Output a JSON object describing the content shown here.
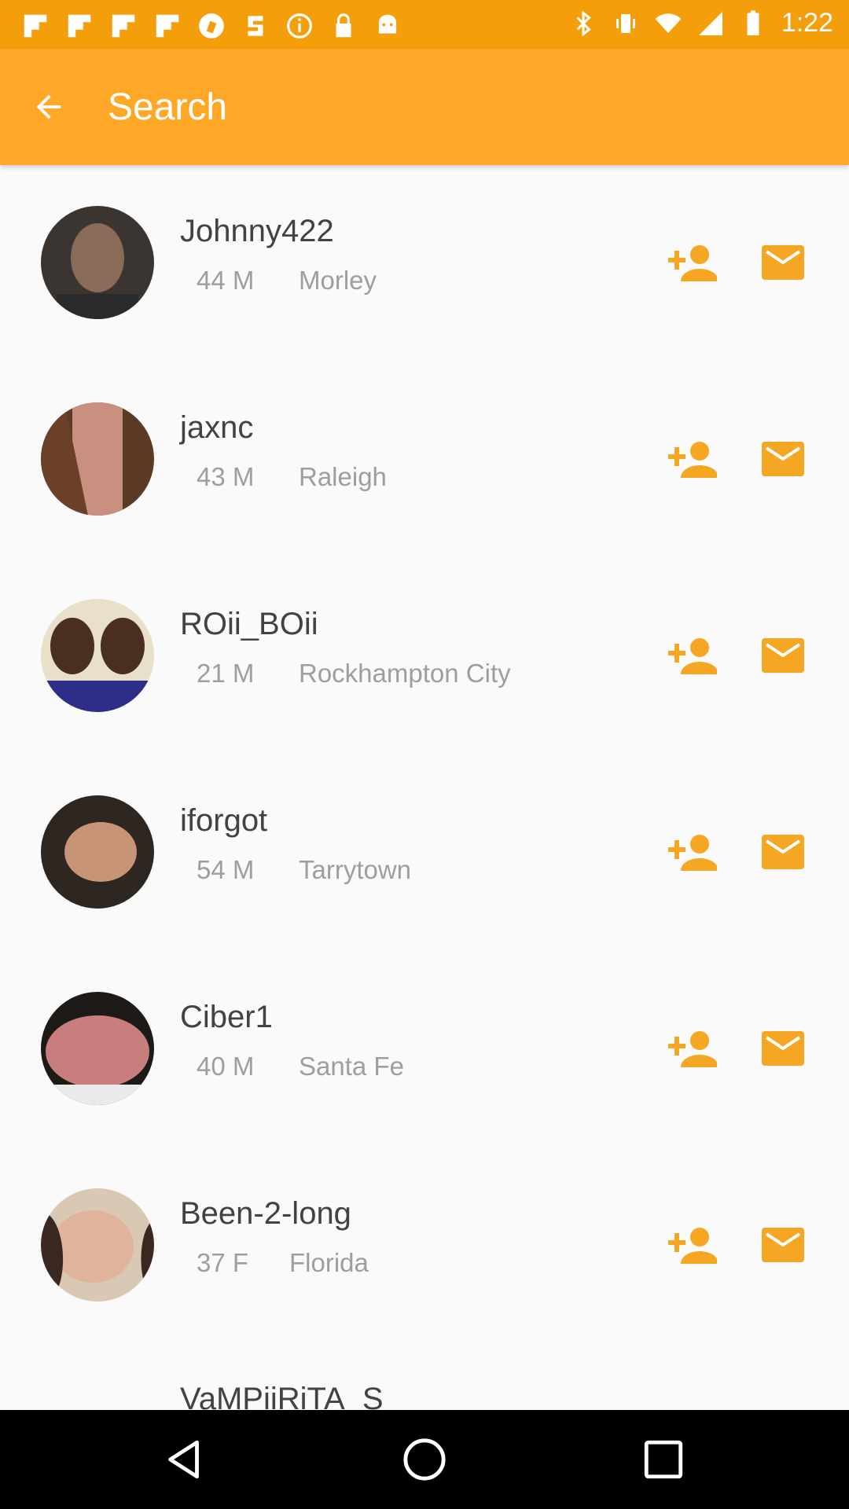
{
  "status_bar": {
    "time": "1:22",
    "left_icons": [
      "flipboard-icon",
      "flipboard-icon",
      "flipboard-icon",
      "flipboard-icon",
      "maps-icon",
      "sharper-icon",
      "info-icon",
      "lock-icon",
      "android-icon"
    ],
    "right_icons": [
      "bluetooth-icon",
      "vibrate-icon",
      "wifi-icon",
      "signal-icon",
      "battery-icon"
    ]
  },
  "app_bar": {
    "title": "Search",
    "back_icon": "arrow-back-icon",
    "color": "#ffa726"
  },
  "results": [
    {
      "username": "Johnny422",
      "age": "44 M",
      "city": "Morley"
    },
    {
      "username": "jaxnc",
      "age": "43 M",
      "city": "Raleigh"
    },
    {
      "username": "ROii_BOii",
      "age": "21 M",
      "city": "Rockhampton City"
    },
    {
      "username": "iforgot",
      "age": "54 M",
      "city": "Tarrytown"
    },
    {
      "username": "Ciber1",
      "age": "40 M",
      "city": "Santa Fe"
    },
    {
      "username": "Been-2-long",
      "age": "37 F",
      "city": "Florida"
    }
  ],
  "partial_result": {
    "username": "VaMPiiRiTA_S"
  },
  "action_icons": {
    "add": "person-add-icon",
    "message": "mail-icon",
    "accent": "#f5a623"
  },
  "nav_bar": {
    "back": "back-triangle-icon",
    "home": "home-circle-icon",
    "recents": "recents-square-icon"
  }
}
